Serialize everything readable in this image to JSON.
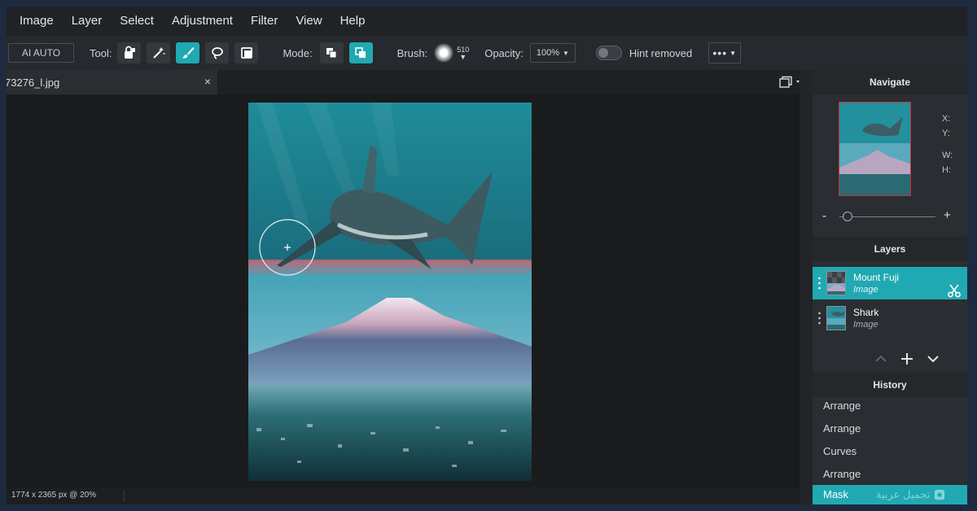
{
  "menu": [
    "Image",
    "Layer",
    "Select",
    "Adjustment",
    "Filter",
    "View",
    "Help"
  ],
  "toolbar": {
    "ai_auto": "AI AUTO",
    "tool_label": "Tool:",
    "mode_label": "Mode:",
    "brush_label": "Brush:",
    "brush_size": "510",
    "opacity_label": "Opacity:",
    "opacity_value": "100%",
    "hint_label": "Hint removed",
    "more_label": "•••"
  },
  "document": {
    "tab_name": "73276_l.jpg",
    "close_glyph": "×",
    "status": "1774 x 2365 px @ 20%"
  },
  "navigate": {
    "title": "Navigate",
    "x_label": "X:",
    "y_label": "Y:",
    "w_label": "W:",
    "h_label": "H:",
    "zoom_out": "-",
    "zoom_in": "+"
  },
  "layers": {
    "title": "Layers",
    "items": [
      {
        "name": "Mount Fuji",
        "type": "Image"
      },
      {
        "name": "Shark",
        "type": "Image"
      }
    ]
  },
  "history": {
    "title": "History",
    "items": [
      "Arrange",
      "Arrange",
      "Curves",
      "Arrange",
      "Mask"
    ]
  },
  "watermark": "تجميل عربية",
  "colors": {
    "accent": "#20a9b2",
    "thumb_border": "#c2323e"
  }
}
